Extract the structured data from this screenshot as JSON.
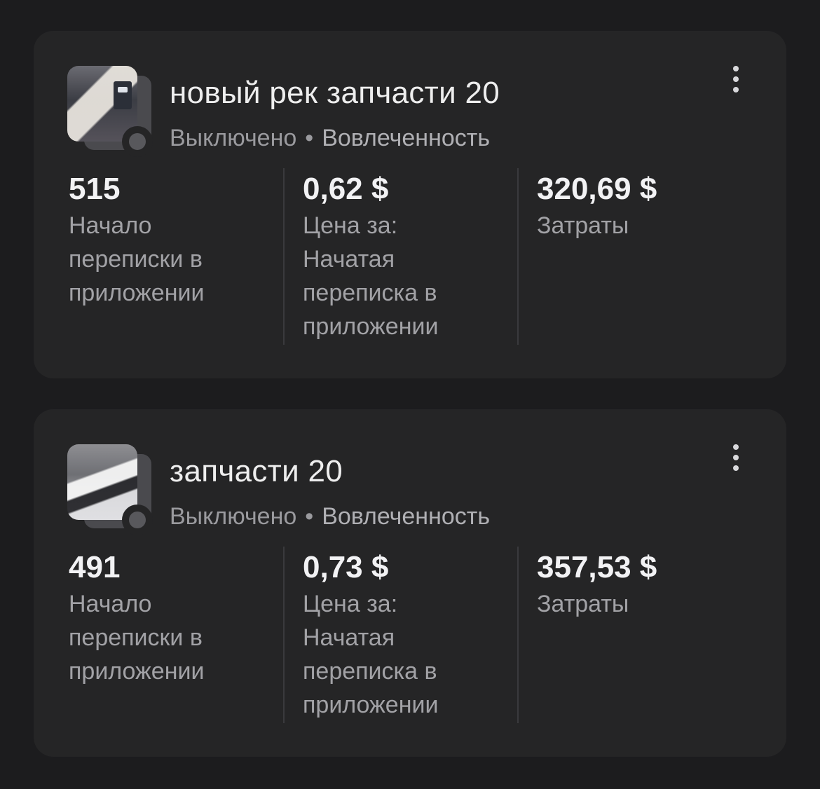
{
  "campaigns": [
    {
      "name": "новый рек запчасти 20",
      "status": "Выключено",
      "separator": "•",
      "objective": "Вовлеченность",
      "thumbnail_icon": "ad-image-thumbnail",
      "status_color": "#58585c",
      "metrics": [
        {
          "value": "515",
          "label": "Начало переписки в приложении"
        },
        {
          "value": "0,62 $",
          "label": "Цена за: Начатая переписка в приложении"
        },
        {
          "value": "320,69 $",
          "label": "Затраты"
        }
      ]
    },
    {
      "name": "запчасти 20",
      "status": "Выключено",
      "separator": "•",
      "objective": "Вовлеченность",
      "thumbnail_icon": "ad-image-thumbnail",
      "status_color": "#58585c",
      "metrics": [
        {
          "value": "491",
          "label": "Начало переписки в приложении"
        },
        {
          "value": "0,73 $",
          "label": "Цена за: Начатая переписка в приложении"
        },
        {
          "value": "357,53 $",
          "label": "Затраты"
        }
      ]
    }
  ],
  "theme": {
    "background": "#1c1c1e",
    "card": "#252526",
    "text_primary": "#eeeeee",
    "text_secondary": "#9a9a9e"
  }
}
